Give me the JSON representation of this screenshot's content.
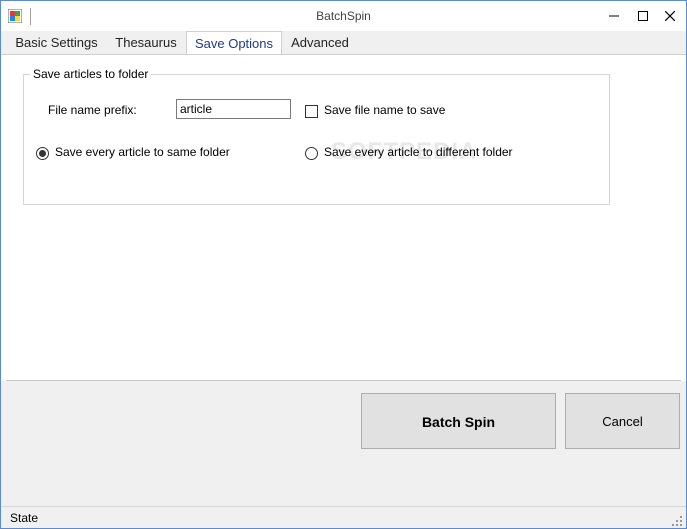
{
  "window": {
    "title": "BatchSpin"
  },
  "tabs": [
    {
      "label": "Basic Settings"
    },
    {
      "label": "Thesaurus"
    },
    {
      "label": "Save Options"
    },
    {
      "label": "Advanced"
    }
  ],
  "active_tab": "Save Options",
  "group": {
    "title": "Save articles to folder",
    "prefix_label": "File name prefix:",
    "prefix_value": "article",
    "save_name_checkbox": {
      "label": "Save file name to save",
      "checked": false
    },
    "radio_same": {
      "label": "Save every article to same folder",
      "checked": true
    },
    "radio_diff": {
      "label": "Save every article to different folder",
      "checked": false
    }
  },
  "watermark": "SOFTPEDIA",
  "buttons": {
    "batch_spin": "Batch Spin",
    "cancel": "Cancel"
  },
  "status": {
    "text": "State"
  },
  "colors": {
    "accent": "#5a8bd1",
    "active_tab_text": "#1e3a8a"
  }
}
